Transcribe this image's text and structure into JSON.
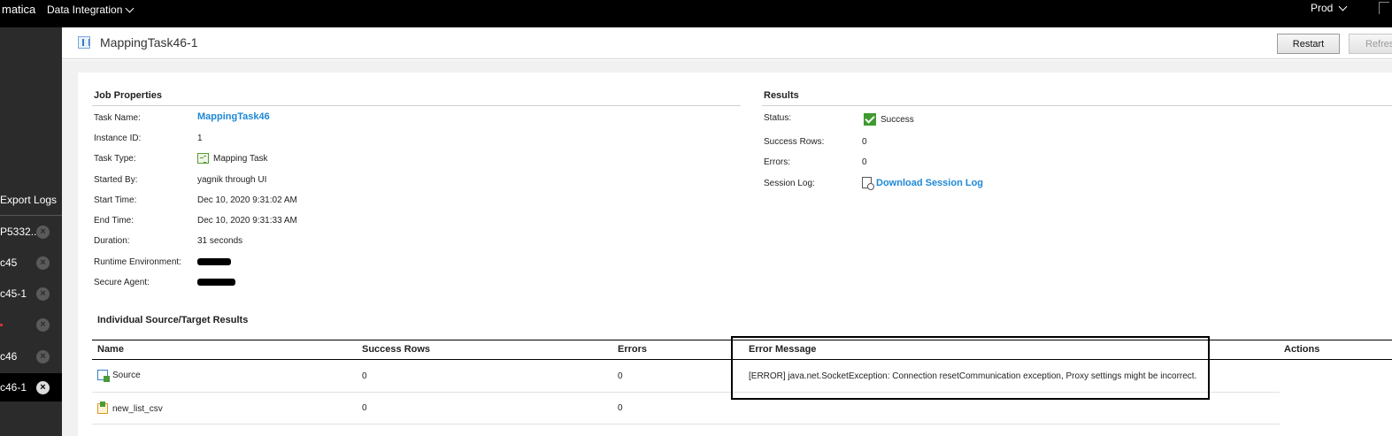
{
  "topbar": {
    "brand": "matica",
    "product": "Data Integration",
    "org": "Prod"
  },
  "left_panel": {
    "export_label": "Export Logs",
    "items": [
      {
        "label": "P5332..."
      },
      {
        "label": "c45"
      },
      {
        "label": "c45-1"
      },
      {
        "label": ""
      },
      {
        "label": "c46"
      },
      {
        "label": "c46-1"
      }
    ]
  },
  "header": {
    "title": "MappingTask46-1",
    "restart_label": "Restart",
    "refresh_label": "Refres"
  },
  "job_properties": {
    "title": "Job Properties",
    "task_name_label": "Task Name:",
    "task_name_value": "MappingTask46",
    "instance_id_label": "Instance ID:",
    "instance_id_value": "1",
    "task_type_label": "Task Type:",
    "task_type_value": "Mapping Task",
    "started_by_label": "Started By:",
    "started_by_value": "yagnik through UI",
    "start_time_label": "Start Time:",
    "start_time_value": "Dec 10, 2020 9:31:02 AM",
    "end_time_label": "End Time:",
    "end_time_value": "Dec 10, 2020 9:31:33 AM",
    "duration_label": "Duration:",
    "duration_value": "31 seconds",
    "runtime_env_label": "Runtime Environment:",
    "secure_agent_label": "Secure Agent:"
  },
  "results": {
    "title": "Results",
    "status_label": "Status:",
    "status_value": "Success",
    "success_rows_label": "Success Rows:",
    "success_rows_value": "0",
    "errors_label": "Errors:",
    "errors_value": "0",
    "session_log_label": "Session Log:",
    "session_log_link": "Download Session Log"
  },
  "source_target": {
    "title": "Individual Source/Target Results",
    "columns": [
      "Name",
      "Success Rows",
      "Errors",
      "Error Message",
      "Actions"
    ],
    "rows": [
      {
        "name": "Source",
        "success_rows": "0",
        "errors": "0",
        "error_message": "[ERROR] java.net.SocketException: Connection resetCommunication exception, Proxy settings might be incorrect."
      },
      {
        "name": "new_list_csv",
        "success_rows": "0",
        "errors": "0",
        "error_message": ""
      }
    ]
  }
}
